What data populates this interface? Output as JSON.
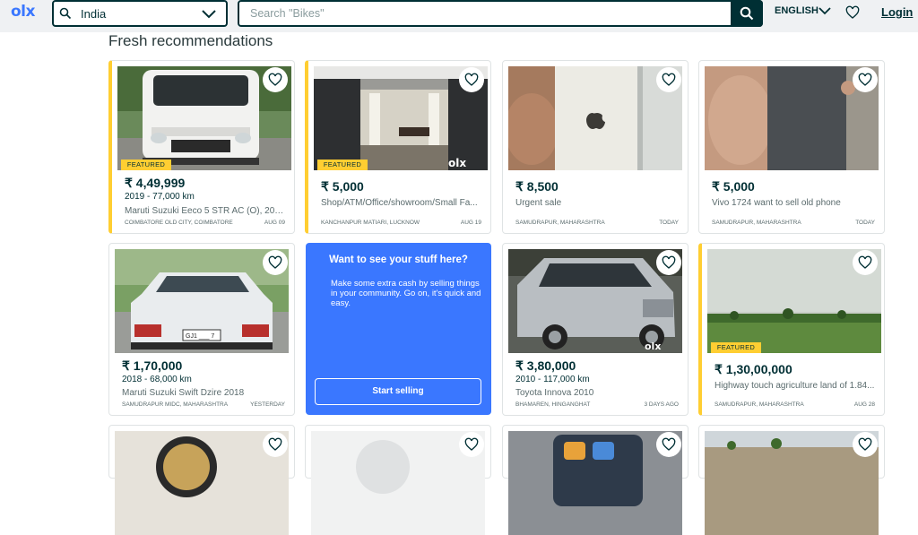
{
  "header": {
    "logo": "olx",
    "location_value": "India",
    "search_placeholder": "Search \"Bikes\"",
    "language": "ENGLISH",
    "login": "Login"
  },
  "section_title": "Fresh recommendations",
  "featured_label": "FEATURED",
  "cards": [
    {
      "price": "₹ 4,49,999",
      "sub": "2019 - 77,000 km",
      "title": "Maruti Suzuki Eeco 5 STR AC (O), 201...",
      "place": "COIMBATORE OLD CITY, COIMBATORE",
      "date": "AUG 09",
      "featured": true
    },
    {
      "price": "₹ 5,000",
      "sub": "",
      "title": "Shop/ATM/Office/showroom/Small Fa...",
      "place": "KANCHANPUR MATIARI, LUCKNOW",
      "date": "AUG 19",
      "featured": true
    },
    {
      "price": "₹ 8,500",
      "sub": "",
      "title": "Urgent sale",
      "place": "SAMUDRAPUR, MAHARASHTRA",
      "date": "TODAY",
      "featured": false
    },
    {
      "price": "₹ 5,000",
      "sub": "",
      "title": "Vivo 1724 want to sell old phone",
      "place": "SAMUDRAPUR, MAHARASHTRA",
      "date": "TODAY",
      "featured": false
    },
    {
      "price": "₹ 1,70,000",
      "sub": "2018 - 68,000 km",
      "title": "Maruti Suzuki Swift Dzire 2018",
      "place": "SAMUDRAPUR MIDC, MAHARASHTRA",
      "date": "YESTERDAY",
      "featured": false
    },
    {
      "price": "₹ 3,80,000",
      "sub": "2010 - 117,000 km",
      "title": "Toyota Innova 2010",
      "place": "BHAMAREN, HINGANGHAT",
      "date": "3 DAYS AGO",
      "featured": false
    },
    {
      "price": "₹ 1,30,00,000",
      "sub": "",
      "title": "Highway touch agriculture land of 1.84...",
      "place": "SAMUDRAPUR, MAHARASHTRA",
      "date": "AUG 28",
      "featured": true
    }
  ],
  "promo": {
    "heading": "Want to see your stuff here?",
    "text": "Make some extra cash by selling things in your community. Go on, it's quick and easy.",
    "button": "Start selling"
  },
  "image_watermark": "olx",
  "plate_text": "GJ1 ___ 7",
  "colors": {
    "brand_dark": "#002f34",
    "featured_yellow": "#ffce32",
    "promo_blue": "#3a77ff",
    "header_bg": "#eff1f3"
  }
}
